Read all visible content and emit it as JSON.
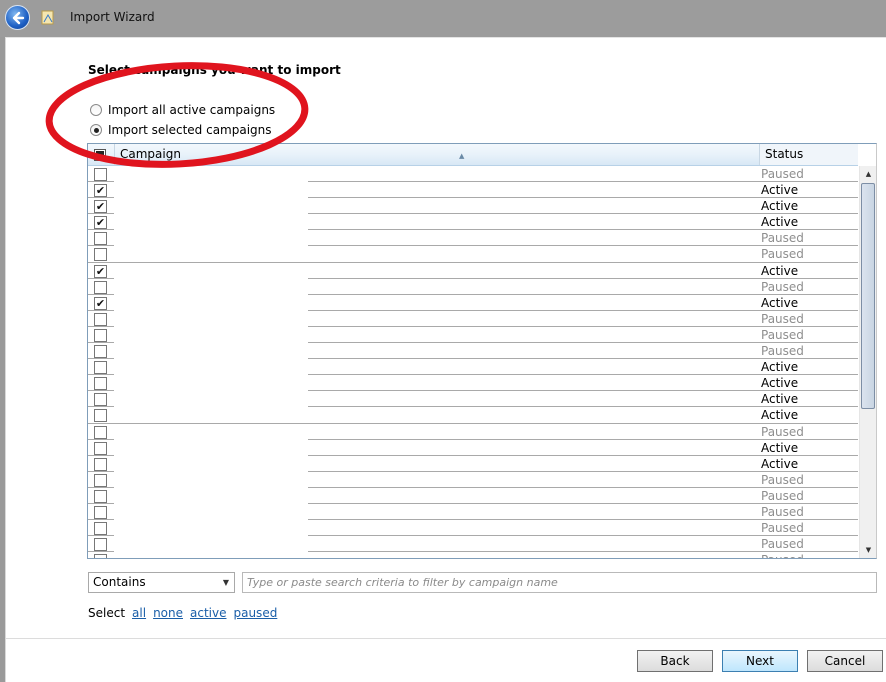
{
  "window": {
    "title": "Import Wizard"
  },
  "page": {
    "heading": "Select campaigns you want to import",
    "options": [
      {
        "label": "Import all active campaigns",
        "selected": false
      },
      {
        "label": "Import selected campaigns",
        "selected": true
      }
    ]
  },
  "grid": {
    "columns": {
      "campaign": "Campaign",
      "status": "Status"
    },
    "rows": [
      {
        "checked": false,
        "status": "Paused"
      },
      {
        "checked": true,
        "status": "Active"
      },
      {
        "checked": true,
        "status": "Active"
      },
      {
        "checked": true,
        "status": "Active"
      },
      {
        "checked": false,
        "status": "Paused"
      },
      {
        "checked": false,
        "status": "Paused"
      },
      {
        "checked": true,
        "status": "Active"
      },
      {
        "checked": false,
        "status": "Paused"
      },
      {
        "checked": true,
        "status": "Active"
      },
      {
        "checked": false,
        "status": "Paused"
      },
      {
        "checked": false,
        "status": "Paused"
      },
      {
        "checked": false,
        "status": "Paused"
      },
      {
        "checked": false,
        "status": "Active"
      },
      {
        "checked": false,
        "status": "Active"
      },
      {
        "checked": false,
        "status": "Active"
      },
      {
        "checked": false,
        "status": "Active"
      },
      {
        "checked": false,
        "status": "Paused"
      },
      {
        "checked": false,
        "status": "Active"
      },
      {
        "checked": false,
        "status": "Active"
      },
      {
        "checked": false,
        "status": "Paused"
      },
      {
        "checked": false,
        "status": "Paused"
      },
      {
        "checked": false,
        "status": "Paused"
      },
      {
        "checked": false,
        "status": "Paused"
      },
      {
        "checked": false,
        "status": "Paused"
      },
      {
        "checked": false,
        "status": "Paused"
      }
    ]
  },
  "filter": {
    "mode": "Contains",
    "placeholder": "Type or paste search criteria to filter by campaign name"
  },
  "select_links": {
    "label": "Select",
    "all": "all",
    "none": "none",
    "active": "active",
    "paused": "paused"
  },
  "buttons": {
    "back": "Back",
    "next": "Next",
    "cancel": "Cancel"
  },
  "colors": {
    "annotation": "#e0141e",
    "link": "#1a5ea8",
    "paused_text": "#8e8e8e"
  }
}
